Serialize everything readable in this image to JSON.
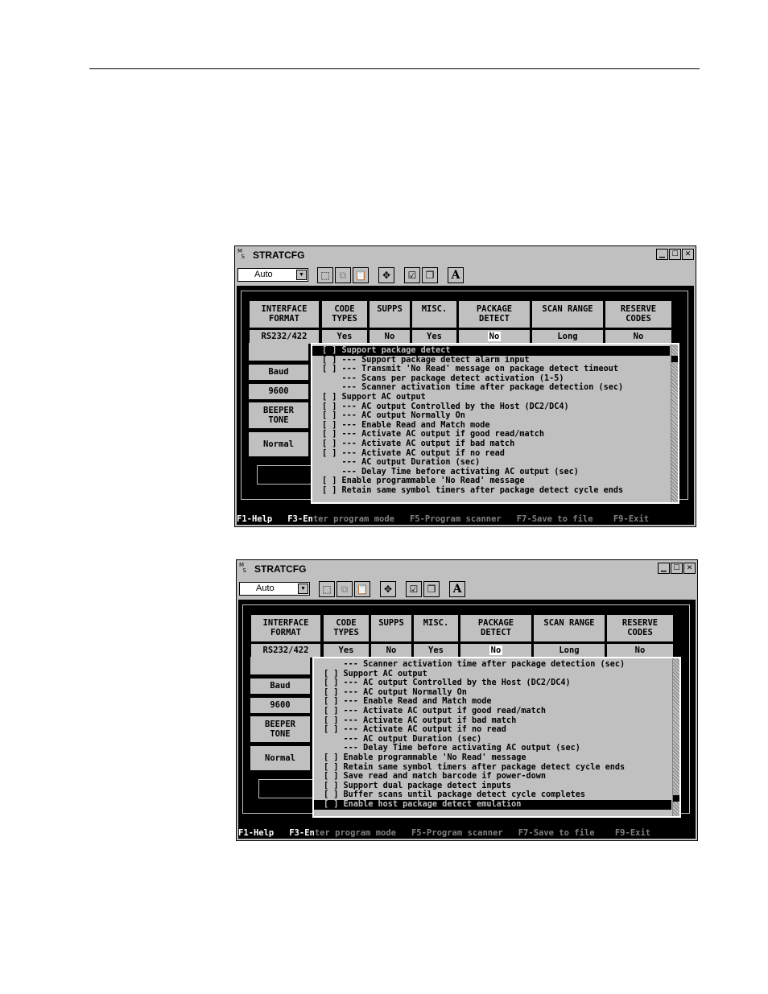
{
  "windows": [
    {
      "title": "STRATCFG",
      "combo_value": "Auto",
      "headers": [
        "INTERFACE\nFORMAT",
        "CODE\nTYPES",
        "SUPPS",
        "MISC.",
        "PACKAGE\nDETECT",
        "SCAN RANGE",
        "RESERVE\nCODES"
      ],
      "values": [
        "RS232/422",
        "Yes",
        "No",
        "Yes",
        "No",
        "Long",
        "No"
      ],
      "side": {
        "baud_label": "Baud",
        "baud_value": "9600",
        "beeper_label": "BEEPER\nTONE",
        "beeper_value": "Normal"
      },
      "status": {
        "f1": "F1-Help",
        "f3a": "F3-En",
        "f3b": "ter program mode",
        "f5": "F5-Program scanner",
        "f7": "F7-Save to file",
        "f9": "F9-Exit"
      },
      "popup_lines": [
        {
          "text": "[ ] Support package detect",
          "selected": true
        },
        {
          "text": "[ ] --- Support package detect alarm input",
          "selected": false
        },
        {
          "text": "[ ] --- Transmit 'No Read' message on package detect timeout",
          "selected": false
        },
        {
          "text": "    --- Scans per package detect activation (1-5)",
          "selected": false
        },
        {
          "text": "    --- Scanner activation time after package detection (sec)",
          "selected": false
        },
        {
          "text": "[ ] Support AC output",
          "selected": false
        },
        {
          "text": "[ ] --- AC output Controlled by the Host (DC2/DC4)",
          "selected": false
        },
        {
          "text": "[ ] --- AC output Normally On",
          "selected": false
        },
        {
          "text": "[ ] --- Enable Read and Match mode",
          "selected": false
        },
        {
          "text": "[ ] --- Activate AC output if good read/match",
          "selected": false
        },
        {
          "text": "[ ] --- Activate AC output if bad match",
          "selected": false
        },
        {
          "text": "[ ] --- Activate AC output if no read",
          "selected": false
        },
        {
          "text": "    --- AC output Duration (sec)",
          "selected": false
        },
        {
          "text": "    --- Delay Time before activating AC output (sec)",
          "selected": false
        },
        {
          "text": "[ ] Enable programmable 'No Read' message",
          "selected": false
        },
        {
          "text": "[ ] Retain same symbol timers after package detect cycle ends",
          "selected": false
        }
      ]
    },
    {
      "title": "STRATCFG",
      "combo_value": "Auto",
      "headers": [
        "INTERFACE\nFORMAT",
        "CODE\nTYPES",
        "SUPPS",
        "MISC.",
        "PACKAGE\nDETECT",
        "SCAN RANGE",
        "RESERVE\nCODES"
      ],
      "values": [
        "RS232/422",
        "Yes",
        "No",
        "Yes",
        "No",
        "Long",
        "No"
      ],
      "side": {
        "baud_label": "Baud",
        "baud_value": "9600",
        "beeper_label": "BEEPER\nTONE",
        "beeper_value": "Normal"
      },
      "status": {
        "f1": "F1-Help",
        "f3a": "F3-En",
        "f3b": "ter program mode",
        "f5": "F5-Program scanner",
        "f7": "F7-Save to file",
        "f9": "F9-Exit"
      },
      "popup_lines": [
        {
          "text": "    --- Scanner activation time after package detection (sec)",
          "selected": false
        },
        {
          "text": "[ ] Support AC output",
          "selected": false
        },
        {
          "text": "[ ] --- AC output Controlled by the Host (DC2/DC4)",
          "selected": false
        },
        {
          "text": "[ ] --- AC output Normally On",
          "selected": false
        },
        {
          "text": "[ ] --- Enable Read and Match mode",
          "selected": false
        },
        {
          "text": "[ ] --- Activate AC output if good read/match",
          "selected": false
        },
        {
          "text": "[ ] --- Activate AC output if bad match",
          "selected": false
        },
        {
          "text": "[ ] --- Activate AC output if no read",
          "selected": false
        },
        {
          "text": "    --- AC output Duration (sec)",
          "selected": false
        },
        {
          "text": "    --- Delay Time before activating AC output (sec)",
          "selected": false
        },
        {
          "text": "[ ] Enable programmable 'No Read' message",
          "selected": false
        },
        {
          "text": "[ ] Retain same symbol timers after package detect cycle ends",
          "selected": false
        },
        {
          "text": "[ ] Save read and match barcode if power-down",
          "selected": false
        },
        {
          "text": "[ ] Support dual package detect inputs",
          "selected": false
        },
        {
          "text": "[ ] Buffer scans until package detect cycle completes",
          "selected": false
        },
        {
          "text": "[ ] Enable host package detect emulation",
          "selected": true
        }
      ]
    }
  ]
}
